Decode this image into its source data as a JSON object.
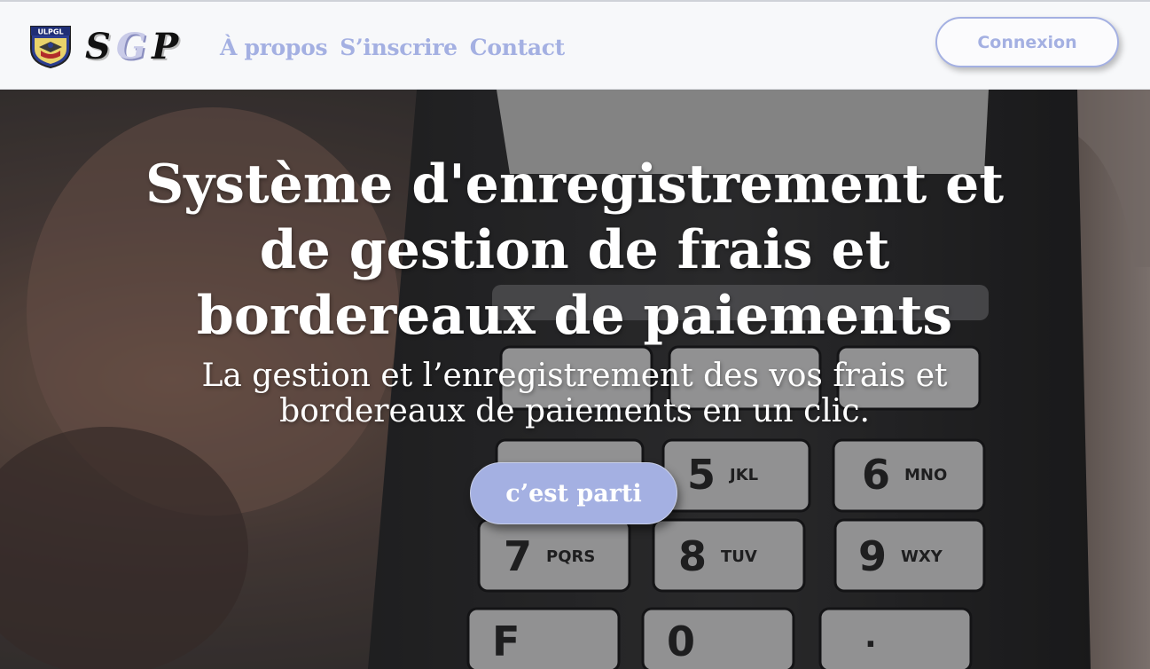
{
  "brand": {
    "crest_text": "ULPGL",
    "logo_letters": [
      "S",
      "G",
      "P"
    ]
  },
  "nav": {
    "links": [
      {
        "label": "À propos"
      },
      {
        "label": "S’inscrire"
      },
      {
        "label": "Contact"
      }
    ],
    "login_label": "Connexion"
  },
  "hero": {
    "title": "Système d'enregistrement et de gestion de frais et bordereaux de paiements",
    "subtitle": "La gestion et l’enregistrement des vos frais et bordereaux de paiements en un clic.",
    "cta_label": "c’est parti",
    "keypad_keys": [
      "5",
      "JKL",
      "6",
      "MNO",
      "7",
      "PQRS",
      "8",
      "TUV",
      "9",
      "WXY",
      "F",
      "0",
      "."
    ]
  },
  "colors": {
    "accent": "#a4b0e2",
    "navbar_bg": "#f7f8fa",
    "text_light": "#ffffff"
  }
}
